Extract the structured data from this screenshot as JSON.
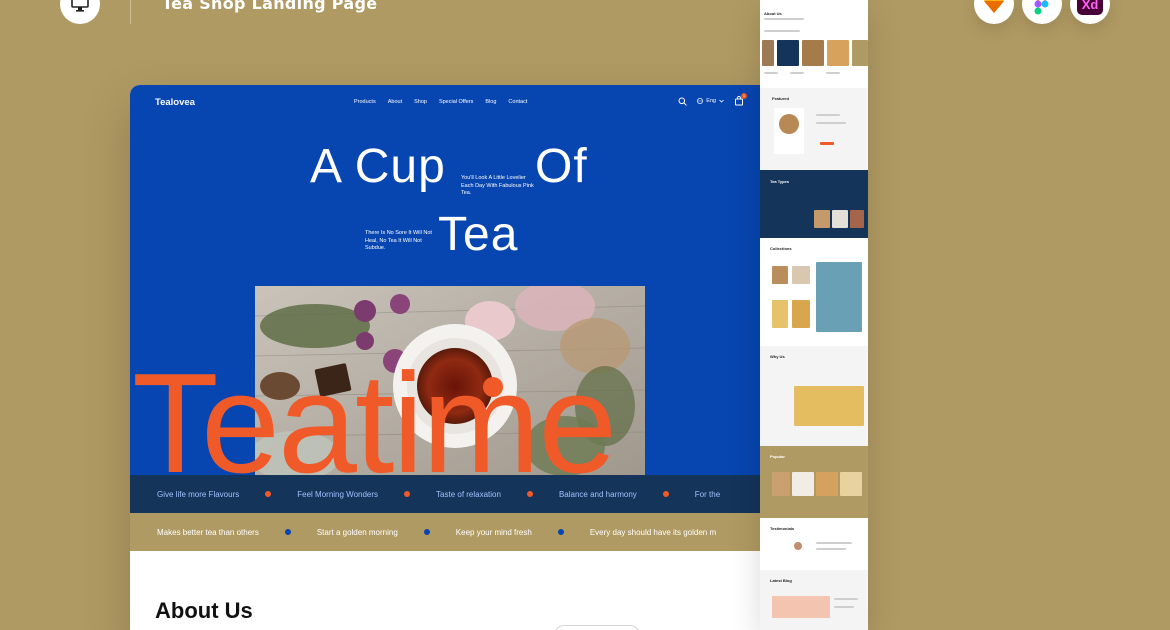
{
  "page": {
    "title": "Tea Shop Landing Page",
    "tools": [
      "sketch-icon",
      "figma-icon",
      "xd-icon"
    ],
    "xd_label": "Xd"
  },
  "colors": {
    "background": "#b09a63",
    "hero_blue": "#0745b0",
    "accent_orange": "#f05a28",
    "ticker_navy": "#14345a"
  },
  "site": {
    "brand": "Tealovea",
    "nav": [
      "Products",
      "About",
      "Shop",
      "Special Offers",
      "Blog",
      "Contact"
    ],
    "lang": "Eng",
    "cart_count": "1"
  },
  "hero": {
    "word_a_cup": "A Cup",
    "word_of": "Of",
    "word_tea": "Tea",
    "copy_right": "You'll Look A Little Lovelier Each Day With Fabulous Pink Tea.",
    "copy_left": "There Is No Sore It Will Not Heal, No Tea It Will Not Subdue.",
    "big_word": "Teatime"
  },
  "ticker_top": [
    "Give life more Flavours",
    "Feel Morning Wonders",
    "Taste of relaxation",
    "Balance and harmony",
    "For the"
  ],
  "ticker_bottom": [
    "Makes better tea than others",
    "Start a golden morning",
    "Keep your mind fresh",
    "Every day should have its golden m"
  ],
  "about": {
    "title": "About Us"
  },
  "strip": {
    "sections": [
      "About Us",
      "Featured",
      "Tea Types",
      "Collections",
      "Why Us",
      "Popular",
      "Testimonials",
      "Latest Blog"
    ]
  }
}
